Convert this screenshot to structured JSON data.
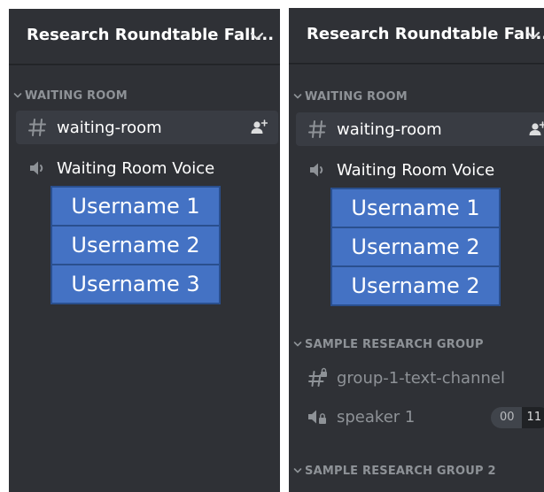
{
  "left": {
    "server_name": "Research Roundtable Fall...",
    "category": "WAITING ROOM",
    "text_channel": "waiting-room",
    "voice_channel": "Waiting Room Voice",
    "users": [
      "Username 1",
      "Username 2",
      "Username 3"
    ]
  },
  "right": {
    "server_name": "Research Roundtable Fall...",
    "category": "WAITING ROOM",
    "text_channel": "waiting-room",
    "voice_channel": "Waiting Room Voice",
    "users": [
      "Username 1",
      "Username 2",
      "Username 2"
    ],
    "category_2": "SAMPLE RESEARCH GROUP",
    "locked_text_channel": "group-1-text-channel",
    "locked_voice_channel": "speaker 1",
    "user_count": "00",
    "user_limit": "11",
    "category_3": "SAMPLE RESEARCH GROUP 2"
  },
  "icons": {
    "chevron": "chevron-down-icon",
    "hash": "hash-icon",
    "speaker": "speaker-icon",
    "add_member": "add-member-icon",
    "locked_hash": "locked-hash-icon",
    "locked_speaker": "locked-speaker-icon"
  },
  "colors": {
    "sidebar_bg": "#2f3136",
    "selected_bg": "#393c43",
    "text_primary": "#ffffff",
    "text_muted": "#8e9297",
    "user_box_bg": "#4472c4"
  }
}
